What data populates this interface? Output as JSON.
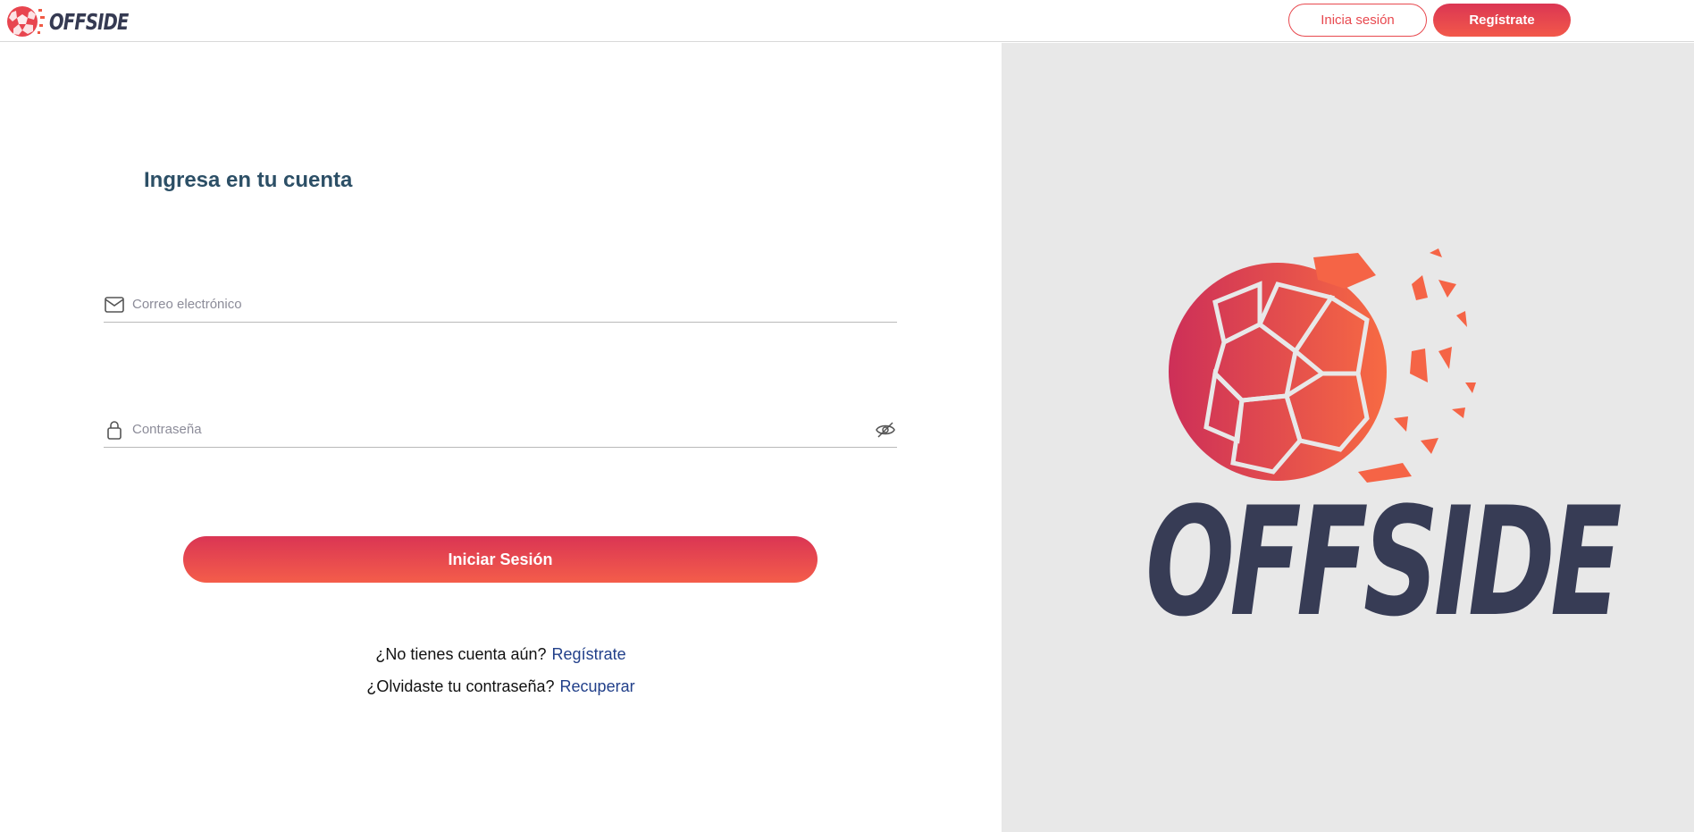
{
  "header": {
    "brand_name": "OFFSIDE",
    "login_label": "Inicia sesión",
    "register_label": "Regístrate"
  },
  "form": {
    "title": "Ingresa en tu cuenta",
    "email_placeholder": "Correo electrónico",
    "password_placeholder": "Contraseña",
    "submit_label": "Iniciar Sesión",
    "no_account_text": "¿No tienes cuenta aún?",
    "register_link": "Regístrate",
    "forgot_text": "¿Olvidaste tu contraseña?",
    "recover_link": "Recuperar"
  },
  "hero": {
    "brand_name": "OFFSIDE"
  },
  "colors": {
    "accent": "#e8494f",
    "accent_dark": "#db3653",
    "brand_text": "#353a52",
    "title": "#2c4f66",
    "link": "#22408a",
    "panel_bg": "#e8e8e8"
  },
  "icons": {
    "email": "mail-icon",
    "password": "lock-icon",
    "visibility": "eye-off-icon",
    "logo": "soccer-ball-icon"
  }
}
